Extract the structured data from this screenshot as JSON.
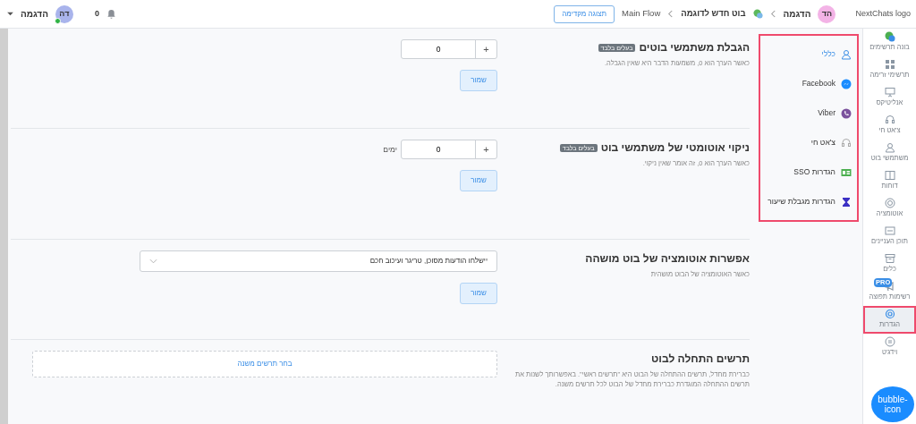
{
  "topbar": {
    "logo_alt": "NextChats logo",
    "workspace": {
      "initials": "הד",
      "name": "הדגמה"
    },
    "breadcrumbs": [
      "בוט חדש לדוגמה",
      "Main Flow"
    ],
    "preview_button": "תצוגה מקדימה",
    "notifications": "0",
    "user": {
      "initials": "דה",
      "name": "הדגמה",
      "online": true
    }
  },
  "sidebar": {
    "items": [
      {
        "label": "בונה תרשימים",
        "selected": false
      },
      {
        "label": "תרשימי זרימה",
        "selected": false
      },
      {
        "label": "אנליטיקס",
        "selected": false
      },
      {
        "label": "צ'אט חי",
        "selected": false
      },
      {
        "label": "משתמשי בוט",
        "selected": false
      },
      {
        "label": "דוחות",
        "selected": false
      },
      {
        "label": "אוטומציה",
        "selected": false
      },
      {
        "label": "תוכן העניינים",
        "selected": false
      },
      {
        "label": "כלים",
        "selected": false
      },
      {
        "label": "רשימות תפוצה",
        "selected": false,
        "badge": "PRO"
      },
      {
        "label": "הגדרות",
        "selected": true
      },
      {
        "label": "וידג'ט",
        "selected": false
      }
    ],
    "bubble_alt": "bubble-icon"
  },
  "settings_menu": [
    {
      "label": "כללי",
      "selected": true
    },
    {
      "label": "Facebook",
      "selected": false
    },
    {
      "label": "Viber",
      "selected": false
    },
    {
      "label": "צ'אט חי",
      "selected": false
    },
    {
      "label": "הגדרות SSO",
      "selected": false
    },
    {
      "label": "הגדרות מגבלת שיעור",
      "selected": false
    }
  ],
  "sections": [
    {
      "kind": "number",
      "title": "הגבלת משתמשי בוטים",
      "badge": "בעלים בלבד",
      "description": "כאשר הערך הוא 0, משמעות הדבר היא שאין הגבלה.",
      "value": "0",
      "plus": "+",
      "save": "שמור"
    },
    {
      "kind": "number",
      "title": "ניקוי אוטומטי של משתמשי בוט",
      "badge": "בעלים בלבד",
      "description": "כאשר הערך הוא 0, זה אומר שאין ניקוי.",
      "value": "0",
      "plus": "+",
      "unit": "ימים",
      "save": "שמור"
    },
    {
      "kind": "select",
      "title": "אפשרות אוטומציה של בוט מושהה",
      "description": "כאשר האוטומציה של הבוט מושהית",
      "value": "יישלחו הודעות מסוכן, טריגר ועיכוב חכם",
      "save": "שמור"
    },
    {
      "kind": "picker",
      "title": "תרשים התחלה לבוט",
      "description": "כברירת מחדל, תרשים ההתחלה של הבוט היא \"תרשים ראשי\". באפשרותך לשנות את תרשים ההתחלה המוגדרת כברירת מחדל של הבוט לכל תרשים משנה.",
      "action": "בחר תרשים משנה"
    }
  ]
}
